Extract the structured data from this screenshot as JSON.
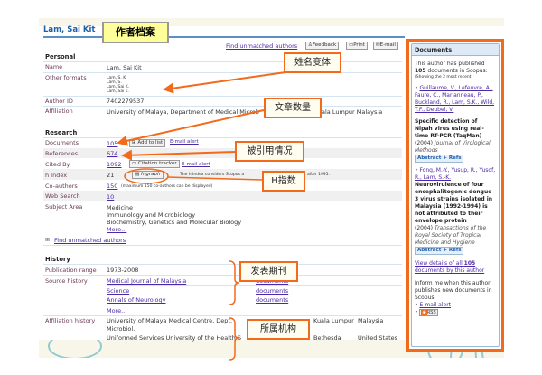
{
  "header": {
    "author_name": "Lam, Sai Kit",
    "label": "作者档案"
  },
  "toolbar": {
    "find_unmatched": "Find unmatched authors",
    "feedback": "Feedback",
    "print": "Print",
    "email": "E-mail"
  },
  "personal": {
    "section": "Personal",
    "name_label": "Name",
    "name": "Lam, Sai Kit",
    "other_formats_label": "Other formats",
    "other_formats": [
      "Lam, S. K.",
      "Lam, S.",
      "Lam, Sai K.",
      "Lam, Sai k."
    ],
    "author_id_label": "Author ID",
    "author_id": "7402279537",
    "affiliation_label": "Affiliation",
    "affiliation_start": "University of Malaya, Department of Medical Microb",
    "affiliation_end": "ala Lumpur  Malaysia"
  },
  "research": {
    "section": "Research",
    "documents_label": "Documents",
    "documents": "105",
    "add_to_list": "Add to list",
    "email_alert": "E-mail alert",
    "references_label": "References",
    "references": "674",
    "cited_by_label": "Cited By",
    "cited_by": "1092",
    "citation_tracker": "Citation tracker",
    "h_index_label": "h Index",
    "h_index": "21",
    "h_graph": "h-graph",
    "h_note_start": "The h Index considers Scopus a",
    "h_note_end": "after 1995.",
    "coauthors_label": "Co-authors",
    "coauthors": "150",
    "coauthors_note": "(maximum 150 co-authors can be displayed)",
    "web_search_label": "Web Search",
    "web_search": "10",
    "subject_area_label": "Subject Area",
    "subjects": [
      "Medicine",
      "Immunology and Microbiology",
      "Biochemistry, Genetics and Molecular Biology"
    ],
    "more": "More...",
    "find_unmatched": "Find unmatched authors"
  },
  "history": {
    "section": "History",
    "pub_range_label": "Publication range",
    "pub_range": "1973-2008",
    "source_history_label": "Source history",
    "sources": [
      "Medical Journal of Malaysia",
      "Science",
      "Annals of Neurology"
    ],
    "documents_link": "documents",
    "more": "More...",
    "affiliation_history_label": "Affiliation history",
    "affiliations": [
      {
        "name": "University of Malaya Medical Centre, Dept.",
        "name2": "Microbiol.",
        "city": "Kuala Lumpur",
        "country": "Malaysia"
      },
      {
        "name": "Uniformed Services University of the Health S",
        "city": "Bethesda",
        "country": "United States"
      }
    ]
  },
  "annotations": {
    "name_variants": "姓名变体",
    "doc_count": "文章数量",
    "citations": "被引用情况",
    "h_index": "H指数",
    "journals": "发表期刊",
    "institutions": "所属机构"
  },
  "sidebar": {
    "title": "Documents",
    "intro_1": "This author has published",
    "count": "105",
    "intro_2": "documents in Scopus:",
    "showing": "(Showing the 2 most recent)",
    "docs": [
      {
        "authors": "Guillaume, V., Lefeuvre, A., Faure, C., Marianneau, P., Buckland, R., Lam, S.K., Wild, T.F., Deubel, V.",
        "title": "Specific detection of Nipah virus using real-time RT-PCR (TaqMan)",
        "year": "(2004)",
        "journal": "Journal of Virological Methods",
        "button": "Abstract + Refs"
      },
      {
        "authors": "Fong, M.-Y., Yusup, R., Yusof, R., Lam, S.-K.",
        "title": "Neurovirulence of four encephalitogenic dengue 3 virus strains isolated in Malaysia (1992-1994) is not attributed to their envelope protein",
        "year": "(2004)",
        "journal": "Transactions of the Royal Society of Tropical Medicine and Hygiene",
        "button": "Abstract + Refs"
      }
    ],
    "view_all_1": "View details of all",
    "view_all_count": "105",
    "view_all_2": "documents by this author",
    "inform": "Inform me when this author publishes new documents in Scopus:",
    "email_alert": "E-mail alert",
    "rss": "RSS"
  },
  "colors": {
    "accent": "#f26a1b",
    "link": "#4b2aa8",
    "title": "#1f5fa8"
  }
}
